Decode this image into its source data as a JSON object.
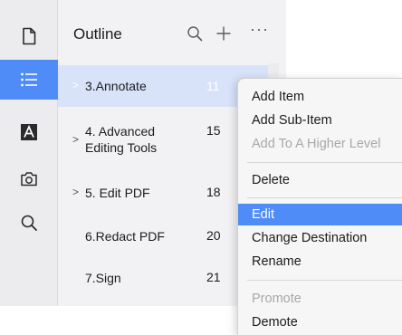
{
  "outline": {
    "title": "Outline",
    "items": [
      {
        "chevron": ">",
        "label": "3.Annotate",
        "page": "11"
      },
      {
        "chevron": ">",
        "label": "4. Advanced Editing Tools",
        "page": "15"
      },
      {
        "chevron": ">",
        "label": "5. Edit PDF",
        "page": "18"
      },
      {
        "chevron": "",
        "label": "6.Redact PDF",
        "page": "20"
      },
      {
        "chevron": "",
        "label": "7.Sign",
        "page": "21"
      }
    ],
    "more": "···"
  },
  "sidebar": {
    "items": [
      {
        "icon": "document-icon"
      },
      {
        "icon": "outline-list-icon"
      },
      {
        "icon": "text-a-icon"
      },
      {
        "icon": "camera-icon"
      },
      {
        "icon": "search-icon"
      }
    ]
  },
  "context_menu": {
    "items": [
      {
        "label": "Add Item"
      },
      {
        "label": "Add Sub-Item"
      },
      {
        "label": "Add To A Higher Level"
      },
      {
        "label": "Delete"
      },
      {
        "label": "Edit"
      },
      {
        "label": "Change Destination"
      },
      {
        "label": "Rename"
      },
      {
        "label": "Promote"
      },
      {
        "label": "Demote"
      }
    ]
  },
  "colors": {
    "accent": "#4f8cf7",
    "selected_row": "#d8e3fa",
    "disabled_text": "#a8a8ac"
  }
}
